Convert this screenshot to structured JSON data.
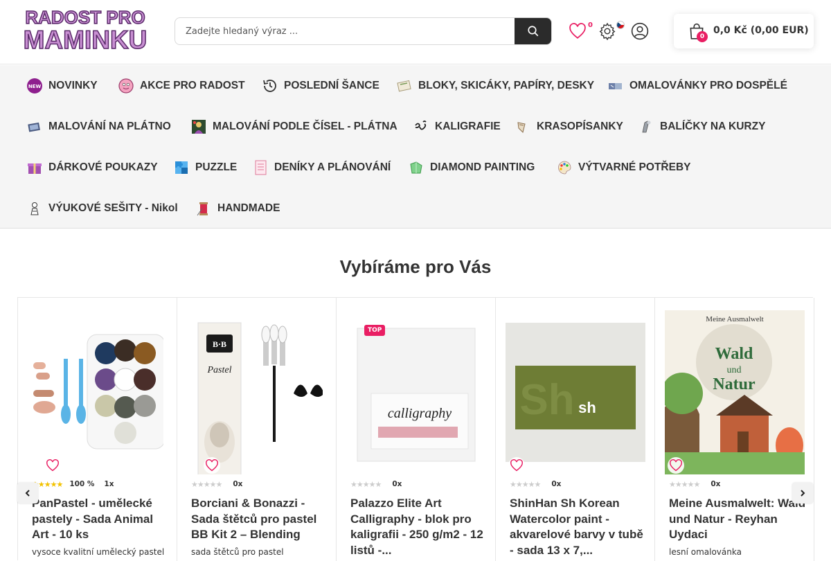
{
  "header": {
    "logo_line1": "RADOST PRO",
    "logo_line2": "MAMINKU",
    "search_placeholder": "Zadejte hledaný výraz ...",
    "favorites_count": "0",
    "cart_count": "0",
    "cart_total": "0,0 Kč (0,00 EUR)"
  },
  "nav": {
    "rows": [
      [
        {
          "label": "NOVINKY",
          "icon": "new-icon"
        },
        {
          "label": "AKCE PRO RADOST",
          "icon": "smiley-icon"
        },
        {
          "label": "POSLEDNÍ ŠANCE",
          "icon": "history-icon"
        },
        {
          "label": "BLOKY, SKICÁKY, PAPÍRY, DESKY",
          "icon": "sketchbook-icon"
        },
        {
          "label": "OMALOVÁNKY PRO DOSPĚLÉ",
          "icon": "coloring-book-icon"
        }
      ],
      [
        {
          "label": "MALOVÁNÍ NA PLÁTNO",
          "icon": "canvas-icon"
        },
        {
          "label": "MALOVÁNÍ PODLE ČÍSEL - PLÁTNA",
          "icon": "paint-by-numbers-icon"
        },
        {
          "label": "KALIGRAFIE",
          "icon": "calligraphy-icon"
        },
        {
          "label": "KRASOPÍSANKY",
          "icon": "pen-icon"
        },
        {
          "label": "BALÍČKY NA KURZY",
          "icon": "course-package-icon"
        }
      ],
      [
        {
          "label": "DÁRKOVÉ POUKAZY",
          "icon": "gift-icon"
        },
        {
          "label": "PUZZLE",
          "icon": "puzzle-icon"
        },
        {
          "label": "DENÍKY A PLÁNOVÁNÍ",
          "icon": "planner-icon"
        },
        {
          "label": "DIAMOND PAINTING",
          "icon": "diamond-icon"
        },
        {
          "label": "VÝTVARNÉ POTŘEBY",
          "icon": "palette-icon"
        }
      ],
      [
        {
          "label": "VÝUKOVÉ SEŠITY - Nikol",
          "icon": "workbook-icon"
        },
        {
          "label": "HANDMADE",
          "icon": "thread-icon"
        }
      ]
    ]
  },
  "section": {
    "title": "Vybíráme pro Vás"
  },
  "products": [
    {
      "title": "PanPastel - umělecké pastely - Sada Animal Art - 10 ks",
      "desc": "vysoce kvalitní umělecký pastel",
      "rating_stars": 5,
      "rating_pct": "100 %",
      "rating_count": "1x",
      "badge": ""
    },
    {
      "title": "Borciani & Bonazzi - Sada štětců pro pastel BB Kit 2 – Blending",
      "desc": "sada štětců pro pastel",
      "rating_stars": 0,
      "rating_pct": "",
      "rating_count": "0x",
      "badge": ""
    },
    {
      "title": "Palazzo Elite Art Calligraphy - blok pro kaligrafii - 250 g/m2 - 12 listů -...",
      "desc": "",
      "rating_stars": 0,
      "rating_pct": "",
      "rating_count": "0x",
      "badge": "TOP"
    },
    {
      "title": "ShinHan Sh Korean Watercolor paint - akvarelové barvy v tubě - sada 13 x 7,...",
      "desc": "",
      "rating_stars": 0,
      "rating_pct": "",
      "rating_count": "0x",
      "badge": ""
    },
    {
      "title": "Meine Ausmalwelt: Wald und Natur - Reyhan Uydaci",
      "desc": "lesní omalovánka",
      "rating_stars": 0,
      "rating_pct": "",
      "rating_count": "0x",
      "badge": ""
    }
  ],
  "product_images": {
    "img3_text": "calligraphy",
    "img4_brand": "sh",
    "img5_header": "Meine Ausmalwelt",
    "img5_title1": "Wald",
    "img5_title2": "und",
    "img5_title3": "Natur",
    "img2_brand": "B·B",
    "img2_label": "Pastel"
  },
  "colors": {
    "accent": "#e91e63",
    "dark": "#2b2b2b",
    "star": "#f2c200"
  }
}
